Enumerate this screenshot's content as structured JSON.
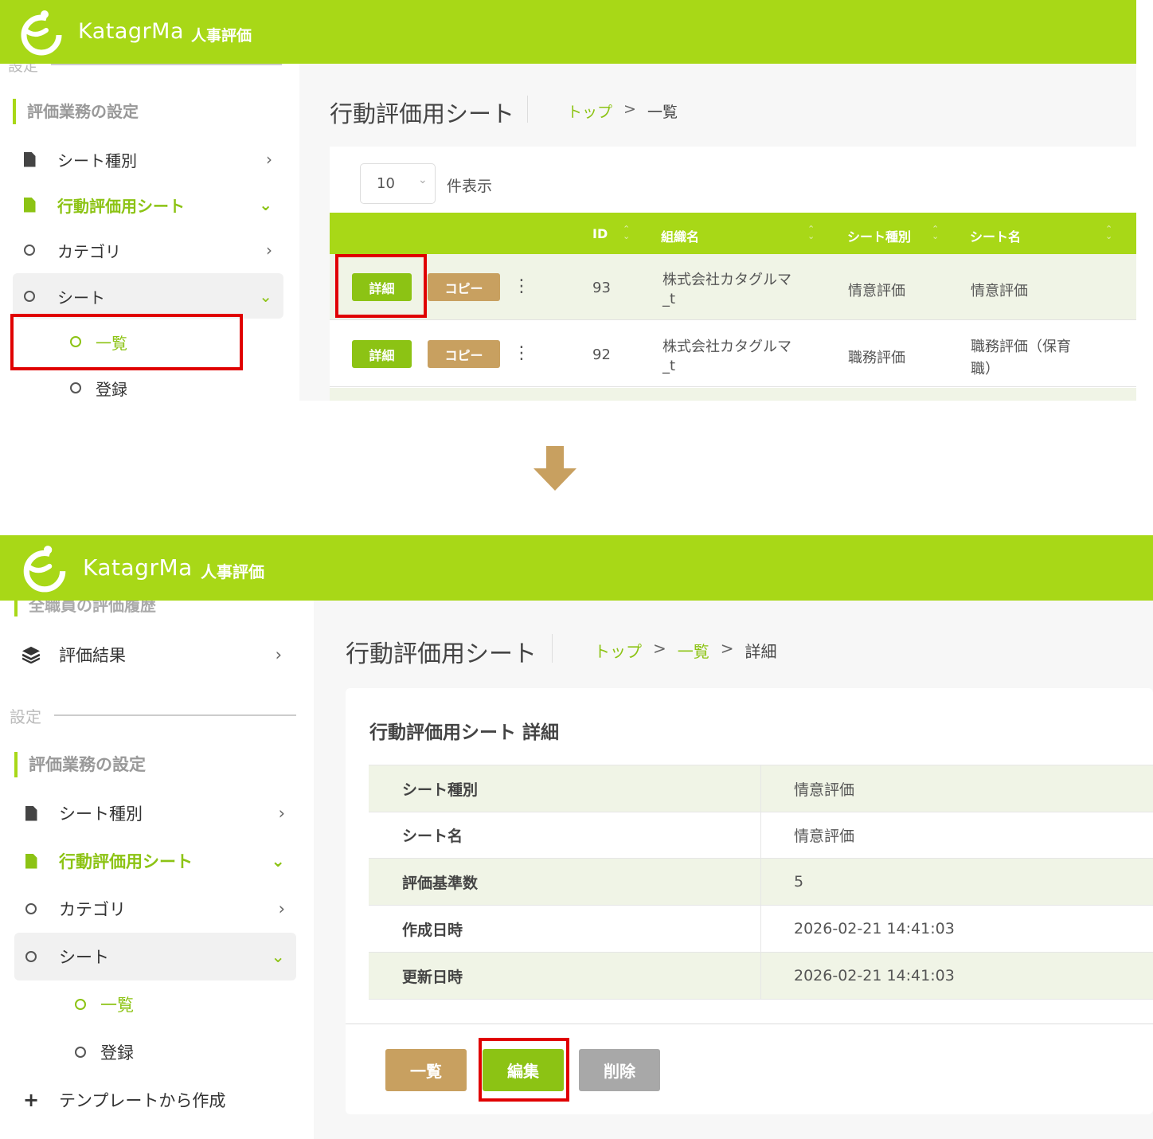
{
  "brand": {
    "name": "KatagrMa",
    "sub": "人事評価"
  },
  "top": {
    "sidebar": {
      "section_cut": "設定",
      "section": "評価業務の設定",
      "items": [
        {
          "label": "シート種別",
          "chev": "›"
        },
        {
          "label": "行動評価用シート",
          "chev": "⌄"
        },
        {
          "label": "カテゴリ",
          "chev": "›"
        },
        {
          "label": "シート",
          "chev": "⌄"
        },
        {
          "label": "一覧"
        },
        {
          "label": "登録"
        }
      ]
    },
    "page_title": "行動評価用シート",
    "breadcrumb": {
      "top": "トップ",
      "sep": ">",
      "current": "一覧"
    },
    "page_size": {
      "value": "10",
      "suffix": "件表示"
    },
    "table": {
      "headers": {
        "id": "ID",
        "org": "組織名",
        "type": "シート種別",
        "name": "シート名"
      },
      "rows": [
        {
          "detail": "詳細",
          "copy": "コピー",
          "more": "⋮",
          "id": "93",
          "org1": "株式会社カタグルマ",
          "org2": "_t",
          "type": "情意評価",
          "name1": "情意評価",
          "name2": ""
        },
        {
          "detail": "詳細",
          "copy": "コピー",
          "more": "⋮",
          "id": "92",
          "org1": "株式会社カタグルマ",
          "org2": "_t",
          "type": "職務評価",
          "name1": "職務評価（保育",
          "name2": "職）"
        }
      ]
    }
  },
  "arrow_color": "#c8a060",
  "bottom": {
    "sidebar": {
      "cut_item": "全職員の評価履歴",
      "results": {
        "label": "評価結果",
        "chev": "›"
      },
      "settings_label": "設定",
      "section": "評価業務の設定",
      "items": [
        {
          "label": "シート種別",
          "chev": "›"
        },
        {
          "label": "行動評価用シート",
          "chev": "⌄"
        },
        {
          "label": "カテゴリ",
          "chev": "›"
        },
        {
          "label": "シート",
          "chev": "⌄"
        },
        {
          "label": "一覧"
        },
        {
          "label": "登録"
        },
        {
          "label": "テンプレートから作成",
          "icon": "+"
        }
      ]
    },
    "page_title": "行動評価用シート",
    "breadcrumb": {
      "top": "トップ",
      "sep": ">",
      "list": "一覧",
      "current": "詳細"
    },
    "card_title": "行動評価用シート 詳細",
    "details": [
      {
        "key": "シート種別",
        "value": "情意評価"
      },
      {
        "key": "シート名",
        "value": "情意評価"
      },
      {
        "key": "評価基準数",
        "value": "5"
      },
      {
        "key": "作成日時",
        "value": "2026-02-21 14:41:03"
      },
      {
        "key": "更新日時",
        "value": "2026-02-21 14:41:03"
      }
    ],
    "buttons": {
      "list": "一覧",
      "edit": "編集",
      "delete": "削除"
    }
  },
  "colors": {
    "brand_green": "#a8d817",
    "accent_green": "#8cc314",
    "tan": "#c8a060",
    "gray": "#a8a8a8",
    "highlight_red": "#e00000"
  }
}
